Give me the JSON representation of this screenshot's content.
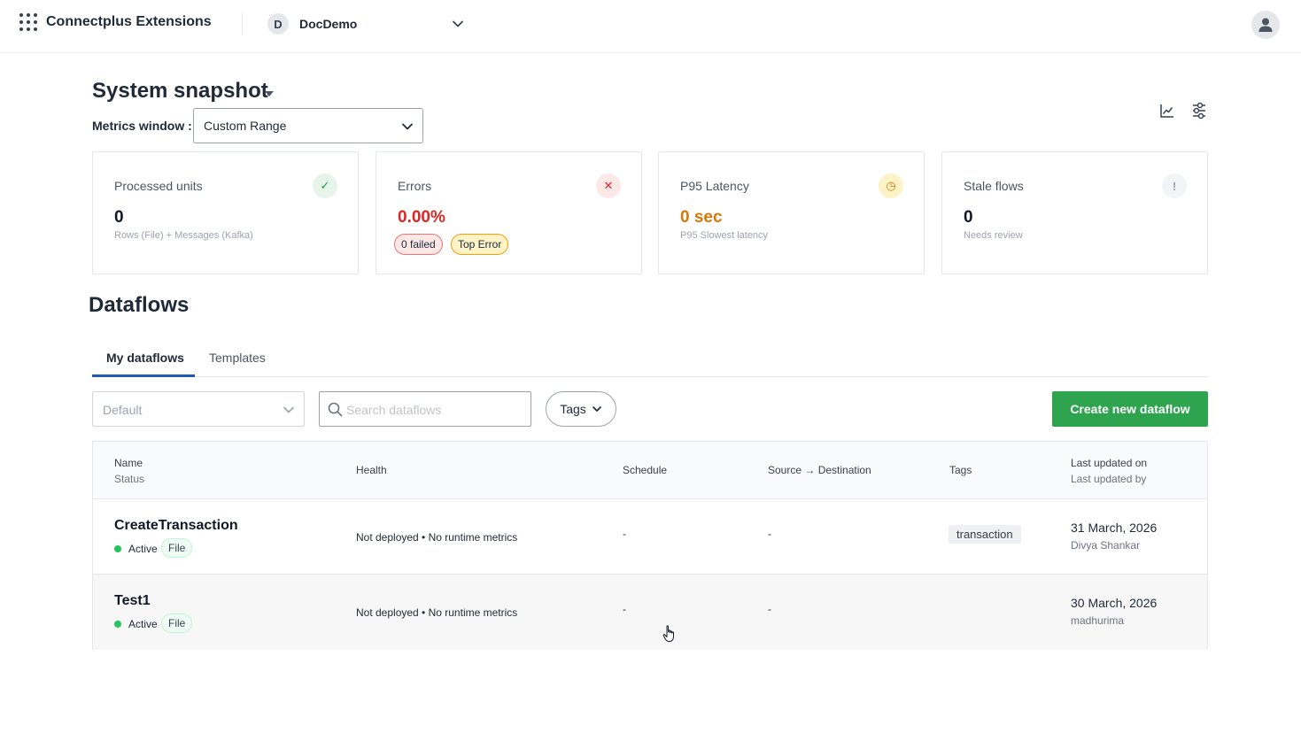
{
  "header": {
    "app_title": "Connectplus Extensions",
    "org_initial": "D",
    "org_name": "DocDemo"
  },
  "snapshot": {
    "title": "System snapshot",
    "metrics_window_label": "Metrics window :",
    "metrics_window_value": "Custom Range",
    "cards": [
      {
        "label": "Processed units",
        "value": "0",
        "sub": "Rows (File) + Messages (Kafka)",
        "badge": "✓"
      },
      {
        "label": "Errors",
        "value": "0.00%",
        "pill_failed": "0 failed",
        "pill_top": "Top Error",
        "badge": "✕"
      },
      {
        "label": "P95 Latency",
        "value": "0 sec",
        "sub": "P95 Slowest latency",
        "badge": "◷"
      },
      {
        "label": "Stale flows",
        "value": "0",
        "sub": "Needs review",
        "badge": "!"
      }
    ]
  },
  "dataflows": {
    "title": "Dataflows",
    "tabs": [
      {
        "label": "My dataflows",
        "active": true
      },
      {
        "label": "Templates",
        "active": false
      }
    ],
    "filter_value": "Default",
    "search_placeholder": "Search dataflows",
    "tags_label": "Tags",
    "create_label": "Create new dataflow",
    "columns": {
      "name": "Name",
      "status": "Status",
      "health": "Health",
      "schedule": "Schedule",
      "source_destination": "Source → Destination",
      "tags": "Tags",
      "last_updated_on": "Last updated on",
      "last_updated_by": "Last updated by"
    },
    "rows": [
      {
        "name": "CreateTransaction",
        "status": "Active",
        "type": "File",
        "health": "Not deployed • No runtime metrics",
        "schedule": "-",
        "source_destination": "-",
        "tag": "transaction",
        "updated_on": "31 March, 2026",
        "updated_by": "Divya Shankar"
      },
      {
        "name": "Test1",
        "status": "Active",
        "type": "File",
        "health": "Not deployed • No runtime metrics",
        "schedule": "-",
        "source_destination": "-",
        "tag": "",
        "updated_on": "30 March, 2026",
        "updated_by": "madhurima"
      }
    ]
  },
  "colors": {
    "accent_blue": "#1e5bb8",
    "create_green": "#2ea44f",
    "error_red": "#dc2626",
    "warn_amber": "#d97706",
    "status_active": "#22c55e"
  },
  "icons": {
    "apps": "apps-grid-icon",
    "org_chevron": "chevron-down-icon",
    "user": "user-icon",
    "chart": "line-chart-icon",
    "settings": "sliders-icon",
    "search": "search-icon",
    "cursor": "hand-pointer-icon"
  }
}
